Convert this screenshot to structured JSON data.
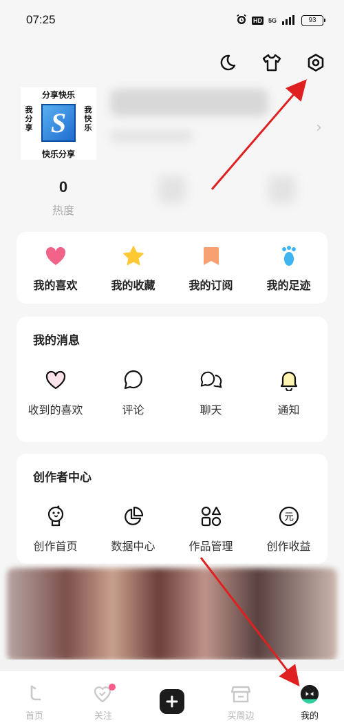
{
  "status_bar": {
    "time": "07:25",
    "hd": "HD",
    "network": "5G",
    "battery": "93"
  },
  "top_icons": [
    {
      "name": "night-mode-moon-icon"
    },
    {
      "name": "outfit-shirt-icon"
    },
    {
      "name": "settings-gear-icon"
    }
  ],
  "profile": {
    "avatar": {
      "caption_top": "分享快乐",
      "caption_bottom": "快乐分享",
      "caption_left": "我分享",
      "caption_right": "我快乐",
      "logo_letter": "S"
    },
    "heat_value": "0",
    "heat_label": "热度"
  },
  "quick_actions": [
    {
      "label": "我的喜欢",
      "icon": "heart-icon",
      "color": "#f2638a"
    },
    {
      "label": "我的收藏",
      "icon": "star-icon",
      "color": "#ffc934"
    },
    {
      "label": "我的订阅",
      "icon": "bookmark-icon",
      "color": "#f7a173"
    },
    {
      "label": "我的足迹",
      "icon": "footprint-icon",
      "color": "#3fb5f0"
    }
  ],
  "messages": {
    "title": "我的消息",
    "items": [
      {
        "label": "收到的喜欢",
        "icon": "heart-outline-icon"
      },
      {
        "label": "评论",
        "icon": "comment-bubble-icon"
      },
      {
        "label": "聊天",
        "icon": "chat-bubbles-icon"
      },
      {
        "label": "通知",
        "icon": "bell-icon"
      }
    ]
  },
  "creator_center": {
    "title": "创作者中心",
    "items": [
      {
        "label": "创作首页",
        "icon": "bird-bulb-icon"
      },
      {
        "label": "数据中心",
        "icon": "pie-chart-icon"
      },
      {
        "label": "作品管理",
        "icon": "shapes-grid-icon"
      },
      {
        "label": "创作收益",
        "icon": "yuan-coin-icon"
      }
    ]
  },
  "tabbar": {
    "tabs": [
      {
        "label": "首页",
        "icon": "home-icon"
      },
      {
        "label": "关注",
        "icon": "follow-icon"
      },
      {
        "label": "",
        "icon": "plus-create-icon"
      },
      {
        "label": "买周边",
        "icon": "shop-icon"
      },
      {
        "label": "我的",
        "icon": "profile-face-icon"
      }
    ],
    "plus_glyph": "+"
  },
  "colors": {
    "annotation_arrow": "#e02020",
    "accent_dark": "#1c1c1c"
  }
}
